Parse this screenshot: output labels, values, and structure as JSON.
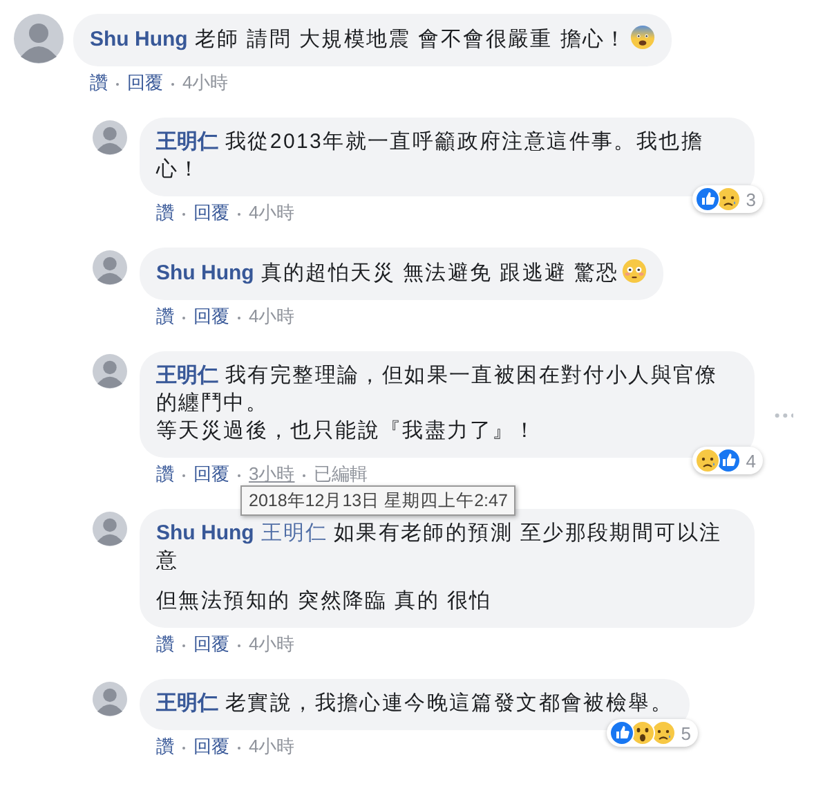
{
  "comments": [
    {
      "author": "Shu Hung",
      "paragraphs": [
        "老師 請問 大規模地震 會不會很嚴重 擔心！"
      ],
      "emoji": {
        "kind": "fearful"
      },
      "like_label": "讚",
      "reply_label": "回覆",
      "time": "4小時",
      "replies": [
        {
          "author": "王明仁",
          "paragraphs": [
            "我從2013年就一直呼籲政府注意這件事。我也擔心！"
          ],
          "like_label": "讚",
          "reply_label": "回覆",
          "time": "4小時",
          "reactions": {
            "icons": [
              {
                "kind": "like"
              },
              {
                "kind": "sad"
              }
            ],
            "count": "3"
          }
        },
        {
          "author": "Shu Hung",
          "paragraphs": [
            "真的超怕天災 無法避免 跟逃避 驚恐"
          ],
          "emoji": {
            "kind": "flushed"
          },
          "like_label": "讚",
          "reply_label": "回覆",
          "time": "4小時"
        },
        {
          "author": "王明仁",
          "paragraphs": [
            "我有完整理論，但如果一直被困在對付小人與官僚的纏鬥中。",
            "等天災過後，也只能說『我盡力了』！"
          ],
          "paragraph_gap": false,
          "like_label": "讚",
          "reply_label": "回覆",
          "time": "3小時",
          "time_hovered": true,
          "edited_label": "已編輯",
          "tooltip": "2018年12月13日 星期四上午2:47",
          "more_button": true,
          "reactions": {
            "icons": [
              {
                "kind": "sad"
              },
              {
                "kind": "like"
              }
            ],
            "count": "4"
          }
        },
        {
          "author": "Shu Hung",
          "mention": "王明仁",
          "paragraphs": [
            "如果有老師的預測 至少那段期間可以注意",
            "但無法預知的 突然降臨 真的 很怕"
          ],
          "paragraph_gap": true,
          "like_label": "讚",
          "reply_label": "回覆",
          "time": "4小時"
        },
        {
          "author": "王明仁",
          "paragraphs": [
            "老實說，我擔心連今晚這篇發文都會被檢舉。"
          ],
          "like_label": "讚",
          "reply_label": "回覆",
          "time": "4小時",
          "reactions": {
            "icons": [
              {
                "kind": "like"
              },
              {
                "kind": "wow"
              },
              {
                "kind": "sad"
              }
            ],
            "count": "5"
          }
        }
      ]
    }
  ]
}
